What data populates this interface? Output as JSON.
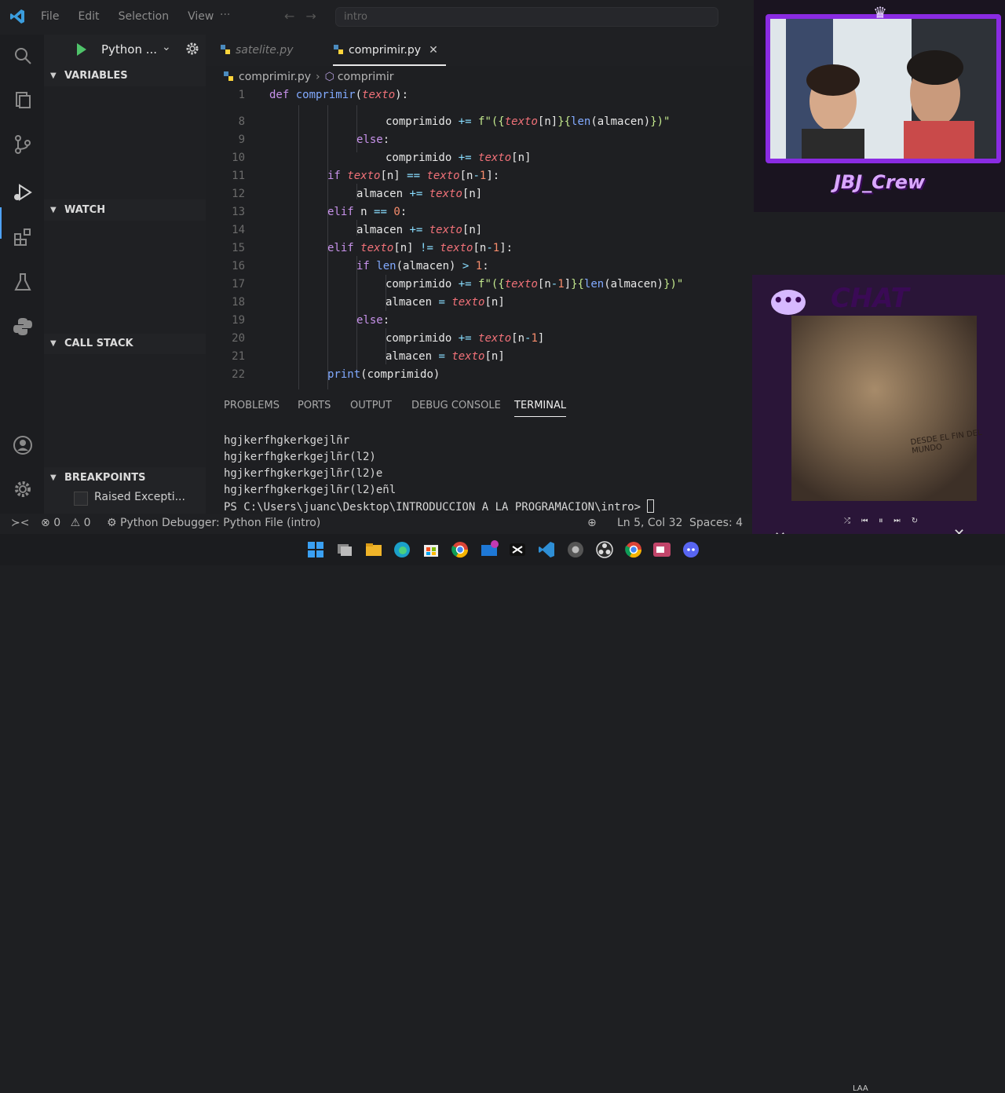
{
  "menu": [
    "File",
    "Edit",
    "Selection",
    "View"
  ],
  "menu_more": "···",
  "search": {
    "placeholder": "intro"
  },
  "run": {
    "config_label": "Python ..."
  },
  "tabs": [
    {
      "label": "satelite.py",
      "active": false
    },
    {
      "label": "comprimir.py",
      "active": true
    }
  ],
  "breadcrumb": {
    "file": "comprimir.py",
    "symbol": "comprimir"
  },
  "sidebar": {
    "variables": "VARIABLES",
    "watch": "WATCH",
    "call_stack": "CALL STACK",
    "breakpoints": "BREAKPOINTS",
    "breakpoint_item": "Raised Excepti..."
  },
  "editor": {
    "lines": [
      {
        "n": "1",
        "tokens": [
          [
            "kw",
            "def "
          ],
          [
            "fn",
            "comprimir"
          ],
          [
            "pl",
            "("
          ],
          [
            "var",
            "texto"
          ],
          [
            "pl",
            "):"
          ]
        ]
      },
      {
        "n": "8",
        "tokens": [
          [
            "pl",
            "comprimido "
          ],
          [
            "op",
            "+="
          ],
          [
            "pl",
            " "
          ],
          [
            "str",
            "f\"({"
          ],
          [
            "var",
            "texto"
          ],
          [
            "pl",
            "[n]"
          ],
          [
            "str",
            "}{"
          ],
          [
            "fn",
            "len"
          ],
          [
            "pl",
            "(almacen)"
          ],
          [
            "str",
            "})\""
          ]
        ]
      },
      {
        "n": "9",
        "tokens": [
          [
            "kw",
            "else"
          ],
          [
            "pl",
            ":"
          ]
        ]
      },
      {
        "n": "10",
        "tokens": [
          [
            "pl",
            "comprimido "
          ],
          [
            "op",
            "+="
          ],
          [
            "pl",
            " "
          ],
          [
            "var",
            "texto"
          ],
          [
            "pl",
            "[n]"
          ]
        ]
      },
      {
        "n": "11",
        "tokens": [
          [
            "kw",
            "if "
          ],
          [
            "var",
            "texto"
          ],
          [
            "pl",
            "[n] "
          ],
          [
            "op",
            "=="
          ],
          [
            "pl",
            " "
          ],
          [
            "var",
            "texto"
          ],
          [
            "pl",
            "[n"
          ],
          [
            "op",
            "-"
          ],
          [
            "num",
            "1"
          ],
          [
            "pl",
            "]:"
          ]
        ]
      },
      {
        "n": "12",
        "tokens": [
          [
            "pl",
            "almacen "
          ],
          [
            "op",
            "+="
          ],
          [
            "pl",
            " "
          ],
          [
            "var",
            "texto"
          ],
          [
            "pl",
            "[n]"
          ]
        ]
      },
      {
        "n": "13",
        "tokens": [
          [
            "kw",
            "elif "
          ],
          [
            "pl",
            "n "
          ],
          [
            "op",
            "=="
          ],
          [
            "pl",
            " "
          ],
          [
            "num",
            "0"
          ],
          [
            "pl",
            ":"
          ]
        ]
      },
      {
        "n": "14",
        "tokens": [
          [
            "pl",
            "almacen "
          ],
          [
            "op",
            "+="
          ],
          [
            "pl",
            " "
          ],
          [
            "var",
            "texto"
          ],
          [
            "pl",
            "[n]"
          ]
        ]
      },
      {
        "n": "15",
        "tokens": [
          [
            "kw",
            "elif "
          ],
          [
            "var",
            "texto"
          ],
          [
            "pl",
            "[n] "
          ],
          [
            "op",
            "!="
          ],
          [
            "pl",
            " "
          ],
          [
            "var",
            "texto"
          ],
          [
            "pl",
            "[n"
          ],
          [
            "op",
            "-"
          ],
          [
            "num",
            "1"
          ],
          [
            "pl",
            "]:"
          ]
        ]
      },
      {
        "n": "16",
        "tokens": [
          [
            "kw",
            "if "
          ],
          [
            "fn",
            "len"
          ],
          [
            "pl",
            "(almacen) "
          ],
          [
            "op",
            ">"
          ],
          [
            "pl",
            " "
          ],
          [
            "num",
            "1"
          ],
          [
            "pl",
            ":"
          ]
        ]
      },
      {
        "n": "17",
        "tokens": [
          [
            "pl",
            "comprimido "
          ],
          [
            "op",
            "+="
          ],
          [
            "pl",
            " "
          ],
          [
            "str",
            "f\"({"
          ],
          [
            "var",
            "texto"
          ],
          [
            "pl",
            "[n"
          ],
          [
            "op",
            "-"
          ],
          [
            "num",
            "1"
          ],
          [
            "pl",
            "]"
          ],
          [
            "str",
            "}{"
          ],
          [
            "fn",
            "len"
          ],
          [
            "pl",
            "(almacen)"
          ],
          [
            "str",
            "})\""
          ]
        ]
      },
      {
        "n": "18",
        "tokens": [
          [
            "pl",
            "almacen "
          ],
          [
            "op",
            "="
          ],
          [
            "pl",
            " "
          ],
          [
            "var",
            "texto"
          ],
          [
            "pl",
            "[n]"
          ]
        ]
      },
      {
        "n": "19",
        "tokens": [
          [
            "kw",
            "else"
          ],
          [
            "pl",
            ":"
          ]
        ]
      },
      {
        "n": "20",
        "tokens": [
          [
            "pl",
            "comprimido "
          ],
          [
            "op",
            "+="
          ],
          [
            "pl",
            " "
          ],
          [
            "var",
            "texto"
          ],
          [
            "pl",
            "[n"
          ],
          [
            "op",
            "-"
          ],
          [
            "num",
            "1"
          ],
          [
            "pl",
            "]"
          ]
        ]
      },
      {
        "n": "21",
        "tokens": [
          [
            "pl",
            "almacen "
          ],
          [
            "op",
            "="
          ],
          [
            "pl",
            " "
          ],
          [
            "var",
            "texto"
          ],
          [
            "pl",
            "[n]"
          ]
        ]
      },
      {
        "n": "22",
        "tokens": [
          [
            "fn",
            "print"
          ],
          [
            "pl",
            "(comprimido)"
          ]
        ]
      }
    ]
  },
  "panel": {
    "tabs": [
      "PROBLEMS",
      "PORTS",
      "OUTPUT",
      "DEBUG CONSOLE",
      "TERMINAL"
    ],
    "active": "TERMINAL"
  },
  "terminal": {
    "lines": [
      "hgjkerfhgkerkgejlñr",
      "hgjkerfhgkerkgejlñr(l2)",
      "hgjkerfhgkerkgejlñr(l2)e",
      "hgjkerfhgkerkgejlñr(l2)eñl"
    ],
    "prompt": "PS C:\\Users\\juanc\\Desktop\\INTRODUCCION A LA PROGRAMACION\\intro> "
  },
  "status": {
    "errors": "0",
    "warnings": "0",
    "debugger": "Python Debugger: Python File (intro)",
    "position": "Ln 5, Col 32",
    "spaces": "Spaces: 4"
  },
  "overlay": {
    "cam_name": "JBJ_Crew",
    "chat_title": "CHAT",
    "chat_bubble": "•••",
    "album_text": "DESDE EL FIN DEL MUNDO",
    "tray_text": "LAA"
  },
  "colors": {
    "accent": "#4ea2f7",
    "run_green": "#4fc36a",
    "overlay_purple": "#8a2be2"
  }
}
